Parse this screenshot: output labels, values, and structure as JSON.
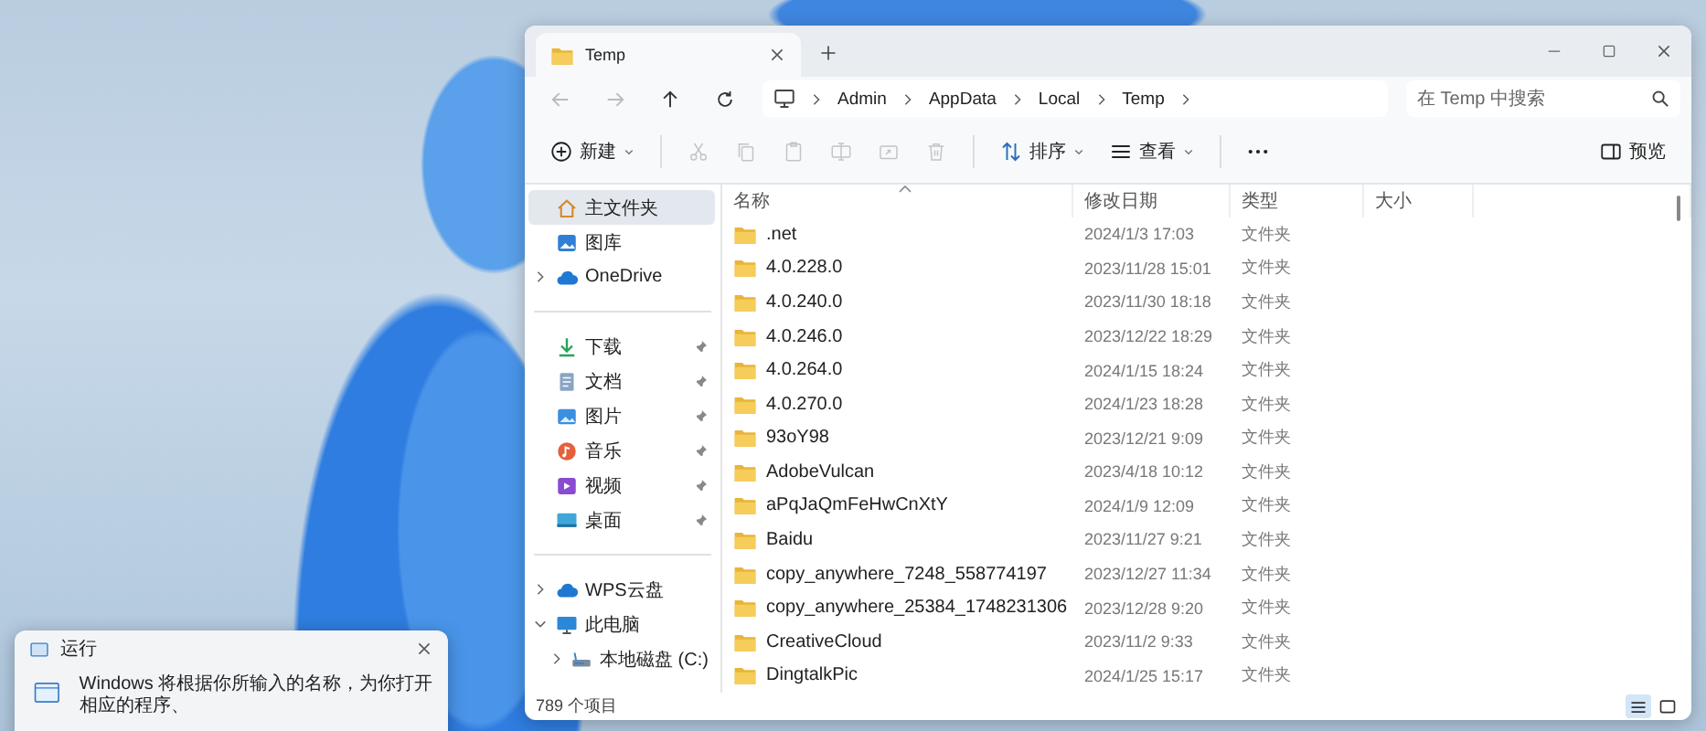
{
  "explorer": {
    "tabs": [
      {
        "label": "Temp",
        "selected": true
      }
    ],
    "nav": [
      {
        "kind": "back",
        "disabled": true
      },
      {
        "kind": "forward",
        "disabled": true
      },
      {
        "kind": "up",
        "disabled": false
      },
      {
        "kind": "refresh",
        "disabled": false
      }
    ],
    "breadcrumb": [
      "Admin",
      "AppData",
      "Local",
      "Temp"
    ],
    "search": {
      "placeholder": "在 Temp 中搜索"
    },
    "toolbar": [
      {
        "kind": "new",
        "label": "新建",
        "disabled": false
      },
      {
        "kind": "cut",
        "disabled": true
      },
      {
        "kind": "copy",
        "disabled": true
      },
      {
        "kind": "paste",
        "disabled": true
      },
      {
        "kind": "rename",
        "disabled": true
      },
      {
        "kind": "share",
        "disabled": true
      },
      {
        "kind": "delete",
        "disabled": true
      },
      {
        "kind": "sort",
        "label": "排序",
        "disabled": false
      },
      {
        "kind": "view",
        "label": "查看",
        "disabled": false
      },
      {
        "kind": "more",
        "disabled": false
      },
      {
        "kind": "preview",
        "label": "预览",
        "disabled": false
      }
    ],
    "sidebar": {
      "sections": [
        {
          "items": [
            {
              "kind": "home",
              "label": "主文件夹",
              "selected": true
            },
            {
              "kind": "gallery",
              "label": "图库",
              "selected": false
            },
            {
              "kind": "cloud",
              "label": "OneDrive",
              "selected": false,
              "expanded": false
            }
          ]
        },
        {
          "items": [
            {
              "kind": "download",
              "label": "下载",
              "selected": false,
              "pinned": true
            },
            {
              "kind": "document",
              "label": "文档",
              "selected": false,
              "pinned": true
            },
            {
              "kind": "picture",
              "label": "图片",
              "selected": false,
              "pinned": true
            },
            {
              "kind": "music",
              "label": "音乐",
              "selected": false,
              "pinned": true
            },
            {
              "kind": "video",
              "label": "视频",
              "selected": false,
              "pinned": true
            },
            {
              "kind": "desktop",
              "label": "桌面",
              "selected": false,
              "pinned": true
            }
          ]
        },
        {
          "items": [
            {
              "kind": "cloud",
              "label": "WPS云盘",
              "selected": false,
              "expanded": false
            },
            {
              "kind": "pc",
              "label": "此电脑",
              "selected": false,
              "expanded": true,
              "children": [
                {
                  "kind": "drive",
                  "label": "本地磁盘 (C:)",
                  "selected": false,
                  "expanded": false
                }
              ]
            }
          ]
        }
      ]
    },
    "table": {
      "columns": [
        {
          "label": "名称",
          "sorted": true
        },
        {
          "label": "修改日期",
          "sorted": false
        },
        {
          "label": "类型",
          "sorted": false
        },
        {
          "label": "大小",
          "sorted": false
        }
      ],
      "rows": [
        {
          "name": ".net",
          "date": "2024/1/3 17:03",
          "type": "文件夹",
          "selected": false
        },
        {
          "name": "4.0.228.0",
          "date": "2023/11/28 15:01",
          "type": "文件夹",
          "selected": false
        },
        {
          "name": "4.0.240.0",
          "date": "2023/11/30 18:18",
          "type": "文件夹",
          "selected": false
        },
        {
          "name": "4.0.246.0",
          "date": "2023/12/22 18:29",
          "type": "文件夹",
          "selected": false
        },
        {
          "name": "4.0.264.0",
          "date": "2024/1/15 18:24",
          "type": "文件夹",
          "selected": false
        },
        {
          "name": "4.0.270.0",
          "date": "2024/1/23 18:28",
          "type": "文件夹",
          "selected": false
        },
        {
          "name": "93oY98",
          "date": "2023/12/21 9:09",
          "type": "文件夹",
          "selected": false
        },
        {
          "name": "AdobeVulcan",
          "date": "2023/4/18 10:12",
          "type": "文件夹",
          "selected": false
        },
        {
          "name": "aPqJaQmFeHwCnXtY",
          "date": "2024/1/9 12:09",
          "type": "文件夹",
          "selected": false
        },
        {
          "name": "Baidu",
          "date": "2023/11/27 9:21",
          "type": "文件夹",
          "selected": false
        },
        {
          "name": "copy_anywhere_7248_558774197",
          "date": "2023/12/27 11:34",
          "type": "文件夹",
          "selected": false
        },
        {
          "name": "copy_anywhere_25384_1748231306",
          "date": "2023/12/28 9:20",
          "type": "文件夹",
          "selected": false
        },
        {
          "name": "CreativeCloud",
          "date": "2023/11/2 9:33",
          "type": "文件夹",
          "selected": false
        },
        {
          "name": "DingtalkPic",
          "date": "2024/1/25 15:17",
          "type": "文件夹",
          "selected": false
        }
      ]
    },
    "status": "789 个项目",
    "views": [
      {
        "kind": "details",
        "selected": true
      },
      {
        "kind": "tiles",
        "selected": false
      }
    ]
  },
  "run_dialog": {
    "title": "运行",
    "message": "Windows 将根据你所输入的名称，为你打开相应的程序、"
  }
}
